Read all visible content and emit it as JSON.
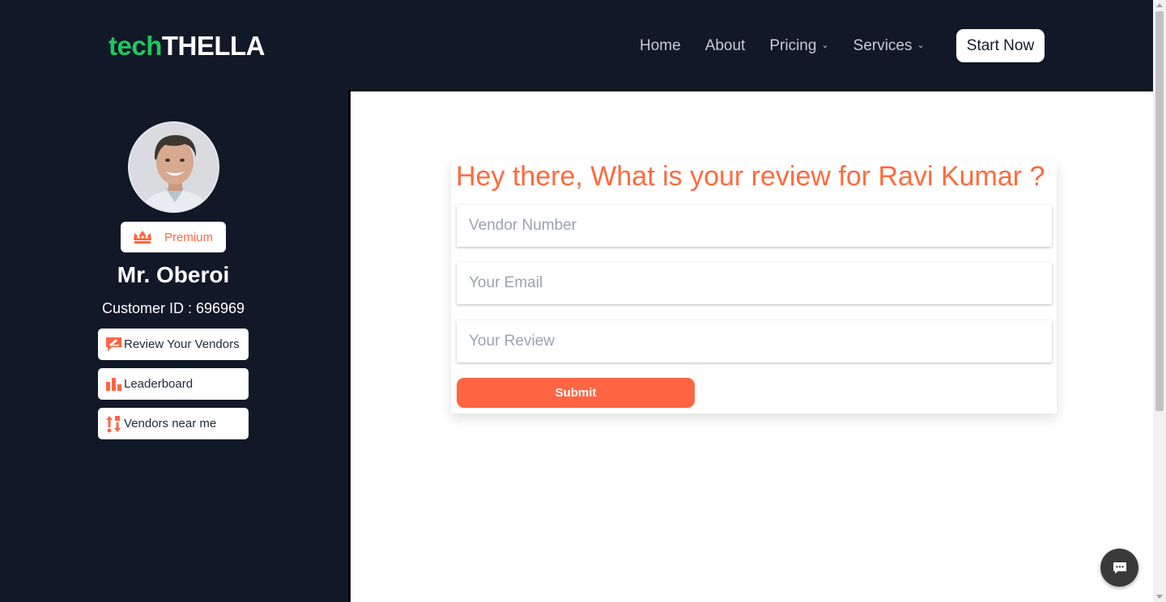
{
  "header": {
    "logo_part1": "tech",
    "logo_part2": "THELLA",
    "nav": [
      {
        "label": "Home",
        "dropdown": false
      },
      {
        "label": "About",
        "dropdown": false
      },
      {
        "label": "Pricing",
        "dropdown": true
      },
      {
        "label": "Services",
        "dropdown": true
      }
    ],
    "cta_label": "Start Now"
  },
  "sidebar": {
    "avatar_icon": "user-photo-icon",
    "badge_label": "Premium",
    "badge_icon": "crown-icon",
    "name": "Mr. Oberoi",
    "customer_id": "Customer ID : 696969",
    "menu": [
      {
        "label": "Review Your Vendors",
        "icon": "review-icon"
      },
      {
        "label": "Leaderboard",
        "icon": "bar-chart-icon"
      },
      {
        "label": "Vendors near me",
        "icon": "sort-icon"
      }
    ]
  },
  "form": {
    "heading": "Hey there, What is your review for Ravi Kumar ?",
    "vendor_placeholder": "Vendor Number",
    "email_placeholder": "Your Email",
    "review_placeholder": "Your Review",
    "submit_label": "Submit"
  },
  "chat": {
    "icon": "chat-icon"
  },
  "colors": {
    "accent": "#ff6542",
    "brand_green": "#22c55e",
    "dark_bg": "#111827"
  }
}
